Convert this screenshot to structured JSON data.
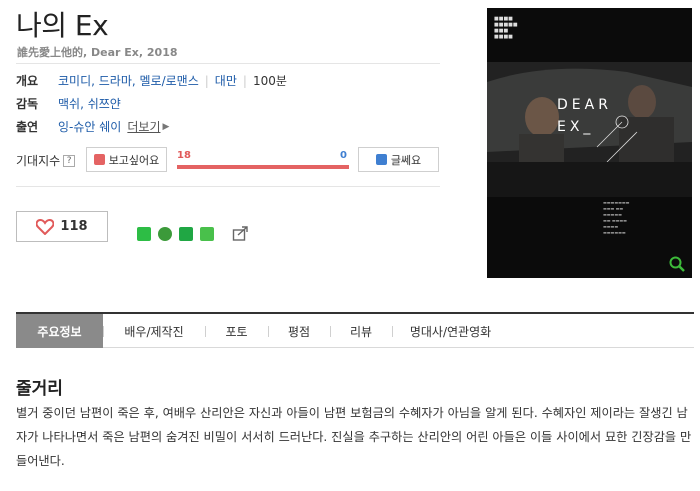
{
  "movie": {
    "title": "나의 Ex",
    "subtitle": "誰先愛上他的, Dear Ex, 2018"
  },
  "info": {
    "overview_key": "개요",
    "genres": "코미디, 드라마, 멜로/로맨스",
    "country": "대만",
    "runtime": "100분",
    "director_key": "감독",
    "director": "맥쉬, 쉬쯔얀",
    "cast_key": "출연",
    "cast": "잉-슈안 쉐이",
    "more_label": "더보기"
  },
  "expectation": {
    "label": "기대지수",
    "help": "?",
    "want_label": "보고싶어요",
    "nope_label": "글쎄요",
    "want_count": "18",
    "nope_count": "0",
    "want_ratio": 1.0,
    "want_color": "#e46363",
    "nope_color": "#3f7fd1"
  },
  "actions": {
    "like_count": "118"
  },
  "share": {
    "icons": [
      "band-icon",
      "kakaostory-icon",
      "bookmark-icon",
      "memo-icon",
      "export-icon"
    ],
    "colors": [
      "#2dbd45",
      "#3c9a3a",
      "#20a744",
      "#49c04b"
    ]
  },
  "poster": {
    "title_line1": "DEAR",
    "title_line2": "EX_"
  },
  "tabs": [
    {
      "label": "주요정보",
      "active": true
    },
    {
      "label": "배우/제작진",
      "active": false
    },
    {
      "label": "포토",
      "active": false
    },
    {
      "label": "평점",
      "active": false
    },
    {
      "label": "리뷰",
      "active": false
    },
    {
      "label": "명대사/연관영화",
      "active": false
    }
  ],
  "synopsis": {
    "heading": "줄거리",
    "text": "별거 중이던 남편이 죽은 후, 여배우 산리안은 자신과 아들이 남편 보험금의 수혜자가 아님을 알게 된다. 수혜자인 제이라는 잘생긴 남자가 나타나면서 죽은 남편의 숨겨진 비밀이 서서히 드러난다. 진실을 추구하는 산리안의 어린 아들은 이들 사이에서 묘한 긴장감을 만들어낸다."
  }
}
